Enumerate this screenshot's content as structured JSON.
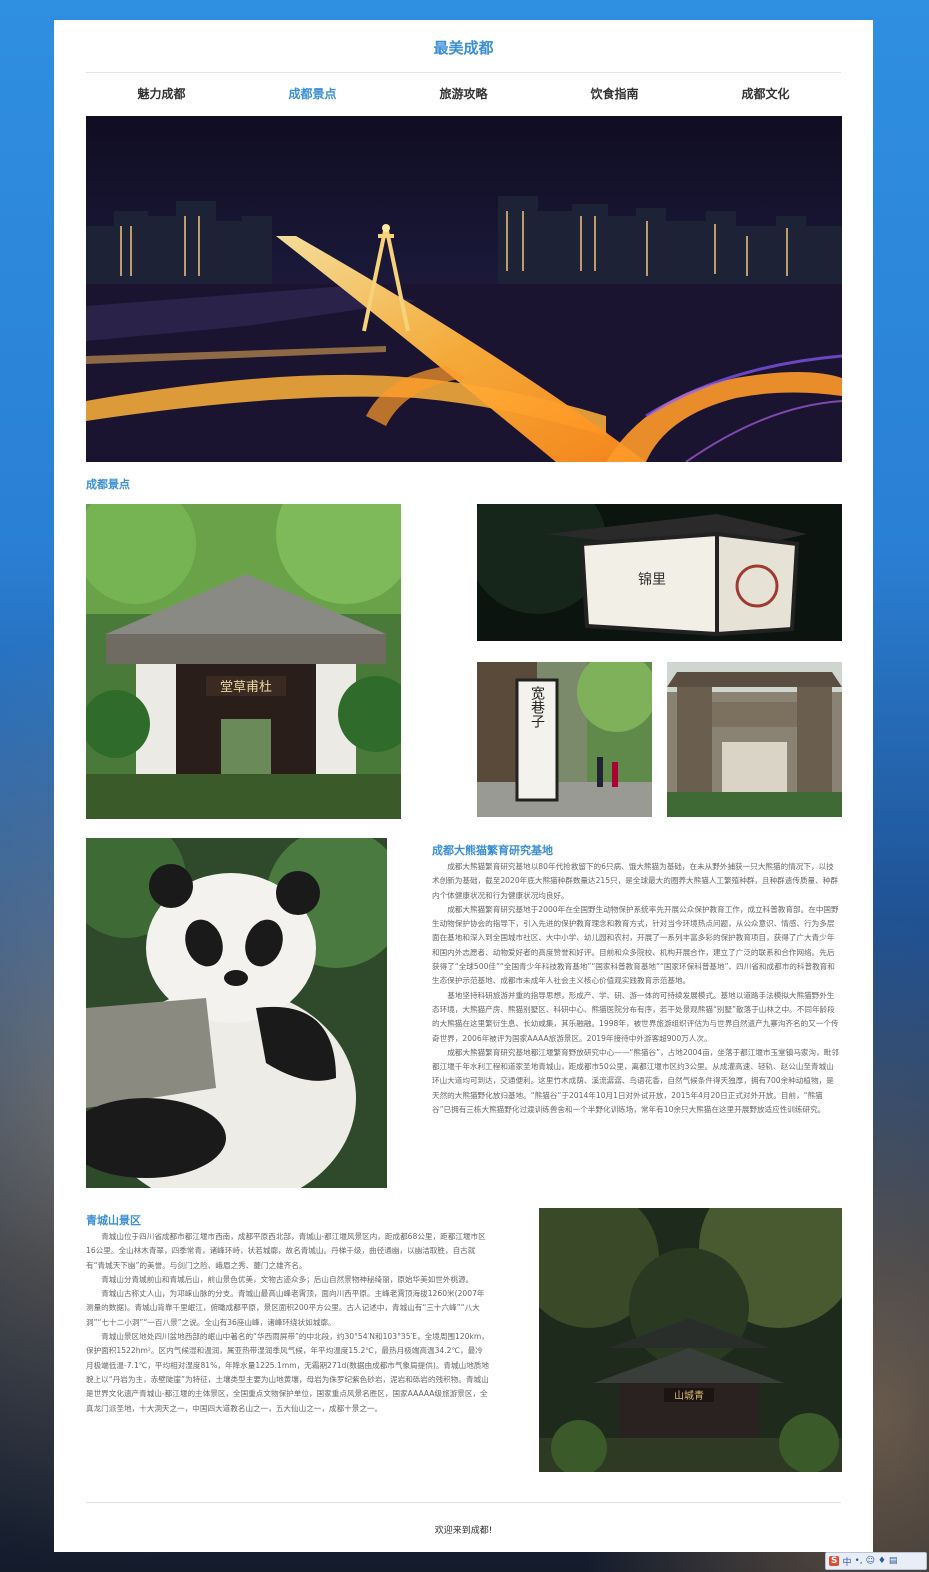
{
  "site": {
    "title": "最美成都"
  },
  "nav": [
    {
      "label": "魅力成都",
      "active": false
    },
    {
      "label": "成都景点",
      "active": true
    },
    {
      "label": "旅游攻略",
      "active": false
    },
    {
      "label": "饮食指南",
      "active": false
    },
    {
      "label": "成都文化",
      "active": false
    }
  ],
  "gallery": {
    "label": "成都景点"
  },
  "photos": [
    {
      "name": "chengdu-night-overpass-photo"
    },
    {
      "name": "du-fu-thatched-cottage-photo",
      "sign": "堂草甫杜"
    },
    {
      "name": "lantern-photo",
      "sign": "锦里"
    },
    {
      "name": "kuanzhai-alley-photo",
      "sign": "宽巷子"
    },
    {
      "name": "wenshu-archway-photo"
    },
    {
      "name": "panda-photo"
    },
    {
      "name": "qingcheng-temple-photo",
      "sign": "山城青"
    }
  ],
  "panda": {
    "heading": "成都大熊猫繁育研究基地",
    "paragraphs": [
      "成都大熊猫繁育研究基地以80年代抢救留下的6只病、饿大熊猫为基础，在未从野外捕获一只大熊猫的情况下，以技术创新为基础，截至2020年底大熊猫种群数量达215只，是全球最大的圈养大熊猫人工繁殖种群，且种群遗传质量、种群内个体健康状况和行为健康状况均良好。",
      "成都大熊猫繁育研究基地于2000年在全国野生动物保护系统率先开展公众保护教育工作，成立科普教育部。在中国野生动物保护协会的指导下，引入先进的保护教育理念和教育方式，针对当今环境热点问题，从公众意识、情感、行为多层面在基地和深入到全国城市社区、大中小学、幼儿园和农村，开展了一系列丰富多彩的保护教育项目，获得了广大青少年和国内外志愿者、动物爱好者的高度赞誉和好评。目前和众多院校、机构开展合作，建立了广泛的联系和合作网络。先后获得了“全球500佳”“全国青少年科技教育基地”“国家科普教育基地”“国家环保科普基地”、四川省和成都市的科普教育和生态保护示范基地、成都市未成年人社会主义核心价值观实践教育示范基地。",
      "基地坚持科研旅游并重的指导思想，形成产、学、研、游一体的可持续发展模式。基地以道路手法模拟大熊猫野外生态环境，大熊猫产房、熊猫别墅区、科研中心、熊猫医院分布有序，若干处景观熊猫“别墅”散落于山林之中。不同年龄段的大熊猫在这里繁衍生息、长幼咸集，其乐融融。1998年，被世界旅游组织评估为与世界自然遗产九寨沟齐名的又一个传奇世界，2006年被评为国家AAAA旅游景区。2019年接待中外游客超900万人次。",
      "成都大熊猫繁育研究基地都江堰繁育野放研究中心——“熊猫谷”，占地2004亩，坐落于都江堰市玉堂镇马家沟，毗邻都江堰千年水利工程和道家圣地青城山，距成都市50公里，离都江堰市区约3公里。从成灌高速、轻轨、赵公山至青城山环山大道均可到达，交通便利。这里竹木成荫、溪流潺潺、鸟语花香，自然气候条件得天独厚，拥有700余种动植物，是天然的大熊猫野化放归基地。“熊猫谷”于2014年10月1日对外试开放，2015年4月20日正式对外开放。目前，“熊猫谷”已拥有三栋大熊猫野化过渡训练兽舍和一个半野化训练场，常年有10余只大熊猫在这里开展野放适应性训练研究。"
    ]
  },
  "qingcheng": {
    "heading": "青城山景区",
    "paragraphs": [
      "青城山位于四川省成都市都江堰市西南，成都平原西北部，青城山-都江堰风景区内，距成都68公里，距都江堰市区16公里。全山林木青翠，四季常青，诸峰环峙，状若城廓，故名青城山。丹梯千级，曲径通幽，以幽洁取胜，自古就有“青城天下幽”的美誉。与剑门之险、峨眉之秀、夔门之雄齐名。",
      "青城山分青城前山和青城后山，前山景色优美，文物古迹众多；后山自然景物神秘绮丽，原始华美如世外桃源。",
      "青城山古称丈人山，为邛崃山脉的分支。青城山最高山峰老霄顶，面向川西平原。主峰老霄顶海拔1260米(2007年测量的数据)。青城山背靠千里岷江，俯瞰成都平原，景区面积200平方公里。古人记述中，青城山有“三十六峰”“八大洞”“七十二小洞”“一百八景”之说。全山有36座山峰，诸峰环绕状如城廓。",
      "青城山景区地处四川盆地西部的岷山中著名的“华西雨屏带”的中北段，约30°54′N和103°35′E，全境周围120km，保护面积1522hm²。区内气候湿和温润，属亚热带湿润季风气候，年平均温度15.2℃，最热月极端高温34.2℃，最冷月极端低温-7.1℃，平均相对湿度81%，年降水量1225.1mm，无霜期271d(数据由成都市气象局提供)。青城山地质地貌上以“丹岩为主，赤壁陡崖”为特征，土壤类型主要为山地黄壤，母岩为侏罗纪紫色砂岩，泥岩和砾岩的残积物。青城山是世界文化遗产青城山-都江堰的主体景区，全国重点文物保护单位，国家重点风景名胜区，国家AAAAA级旅游景区，全真龙门派圣地，十大洞天之一，中国四大道教名山之一，五大仙山之一，成都十景之一。"
    ]
  },
  "footer": {
    "text": "欢迎来到成都!"
  },
  "taskbar": {
    "ime_logo": "S",
    "ime_mode": "中",
    "ime_punct": "•,",
    "ime_icons": "☺ ♦ ▤"
  }
}
